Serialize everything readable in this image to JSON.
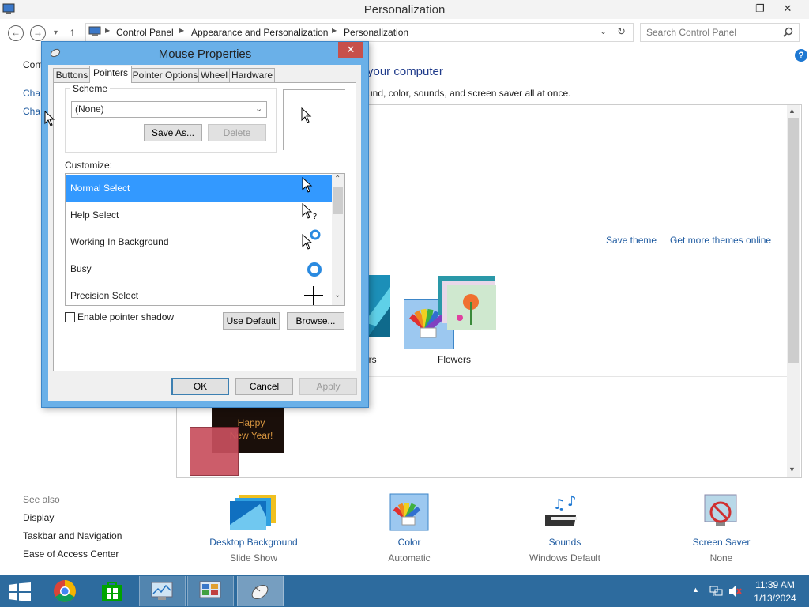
{
  "window": {
    "title": "Personalization",
    "minimize": "—",
    "restore": "❐",
    "close": "✕"
  },
  "address": {
    "crumbs": [
      "Control Panel",
      "Appearance and Personalization",
      "Personalization"
    ],
    "search_placeholder": "Search Control Panel"
  },
  "main": {
    "heading_partial": "your computer",
    "desc_partial": "und, color, sounds, and screen saver all at once.",
    "sidebar_partial": [
      "Cont",
      "Cha",
      "Cha"
    ],
    "save_theme": "Save theme",
    "get_more_themes": "Get more themes online",
    "themes": [
      {
        "name": "ors"
      },
      {
        "name": "Flowers"
      }
    ],
    "new_year_text": "Happy New Year!"
  },
  "see_also": {
    "heading": "See also",
    "links": [
      "Display",
      "Taskbar and Navigation",
      "Ease of Access Center"
    ]
  },
  "bottom_items": [
    {
      "label": "Desktop Background",
      "sub": "Slide Show"
    },
    {
      "label": "Color",
      "sub": "Automatic"
    },
    {
      "label": "Sounds",
      "sub": "Windows Default"
    },
    {
      "label": "Screen Saver",
      "sub": "None"
    }
  ],
  "dialog": {
    "title": "Mouse Properties",
    "close": "✕",
    "tabs": [
      "Buttons",
      "Pointers",
      "Pointer Options",
      "Wheel",
      "Hardware"
    ],
    "active_tab": "Pointers",
    "scheme_label": "Scheme",
    "scheme_value": "(None)",
    "save_as": "Save As...",
    "delete": "Delete",
    "customize_label": "Customize:",
    "pointers": [
      "Normal Select",
      "Help Select",
      "Working In Background",
      "Busy",
      "Precision Select"
    ],
    "enable_shadow": "Enable pointer shadow",
    "use_default": "Use Default",
    "browse": "Browse...",
    "ok": "OK",
    "cancel": "Cancel",
    "apply": "Apply"
  },
  "taskbar": {
    "time": "11:39 AM",
    "date": "1/13/2024"
  },
  "colors": {
    "accent": "#3399ff",
    "taskbar": "#2d6b9e",
    "link": "#1e5aa0",
    "dialog_frame": "#6ab0e8"
  }
}
